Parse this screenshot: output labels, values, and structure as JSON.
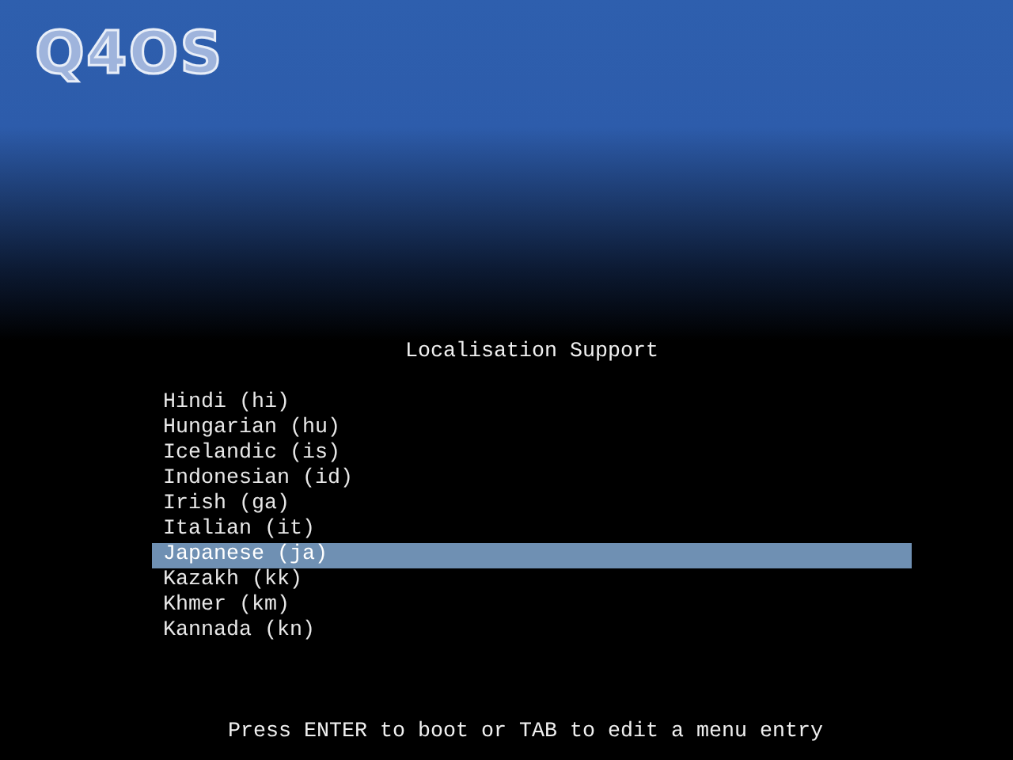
{
  "logo": "Q4OS",
  "menu": {
    "title": "Localisation Support",
    "items": [
      {
        "label": "Hindi (hi)",
        "selected": false
      },
      {
        "label": "Hungarian (hu)",
        "selected": false
      },
      {
        "label": "Icelandic (is)",
        "selected": false
      },
      {
        "label": "Indonesian (id)",
        "selected": false
      },
      {
        "label": "Irish (ga)",
        "selected": false
      },
      {
        "label": "Italian (it)",
        "selected": false
      },
      {
        "label": "Japanese (ja)",
        "selected": true
      },
      {
        "label": "Kazakh (kk)",
        "selected": false
      },
      {
        "label": "Khmer (km)",
        "selected": false
      },
      {
        "label": "Kannada (kn)",
        "selected": false
      }
    ]
  },
  "footer": "Press ENTER to boot or TAB to edit a menu entry"
}
